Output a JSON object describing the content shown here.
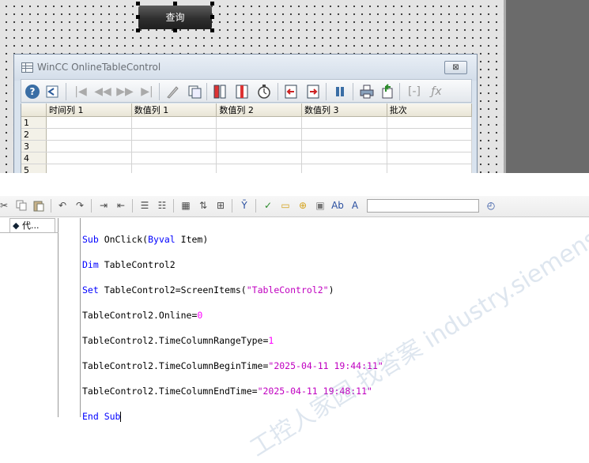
{
  "canvas": {
    "query_button_label": "查询"
  },
  "table_control": {
    "title": "WinCC OnlineTableControl",
    "close_symbol": "⊠",
    "toolbar_icons": [
      "help-icon",
      "config-icon",
      "first-record-icon",
      "previous-record-icon",
      "next-record-icon",
      "last-record-icon",
      "edit-icon",
      "copy-rows-icon",
      "select-columns-icon",
      "select-data-connection-icon",
      "time-range-icon",
      "previous-column-icon",
      "next-column-icon",
      "stop-icon",
      "print-icon",
      "export-icon",
      "statistics-area-icon",
      "statistics-icon"
    ],
    "columns": [
      "时间列 1",
      "数值列 1",
      "数值列 2",
      "数值列 3",
      "批次"
    ],
    "rows": [
      "1",
      "2",
      "3",
      "4",
      "5"
    ]
  },
  "editor": {
    "pane_tab_label": "代...",
    "code_lines": [
      {
        "kw1": "Sub",
        "text": " OnClick(",
        "kw2": "Byval",
        "tail": " Item)"
      },
      {
        "kw1": "Dim",
        "text": " TableControl2"
      },
      {
        "kw1": "Set",
        "text": " TableControl2=ScreenItems(",
        "str": "\"TableControl2\"",
        "tail": ")"
      },
      {
        "text": "TableControl2.Online=",
        "num": "0"
      },
      {
        "text": "TableControl2.TimeColumnRangeType=",
        "num": "1"
      },
      {
        "text": "TableControl2.TimeColumnBeginTime=",
        "str": "\"2025-04-11 19:44:11\""
      },
      {
        "text": "TableControl2.TimeColumnEndTime=",
        "str": "\"2025-04-11 19:48:11\""
      },
      {
        "kw1": "End Sub"
      }
    ]
  },
  "watermark": "工控人家园 找答案 industry.siemens.com/cs"
}
